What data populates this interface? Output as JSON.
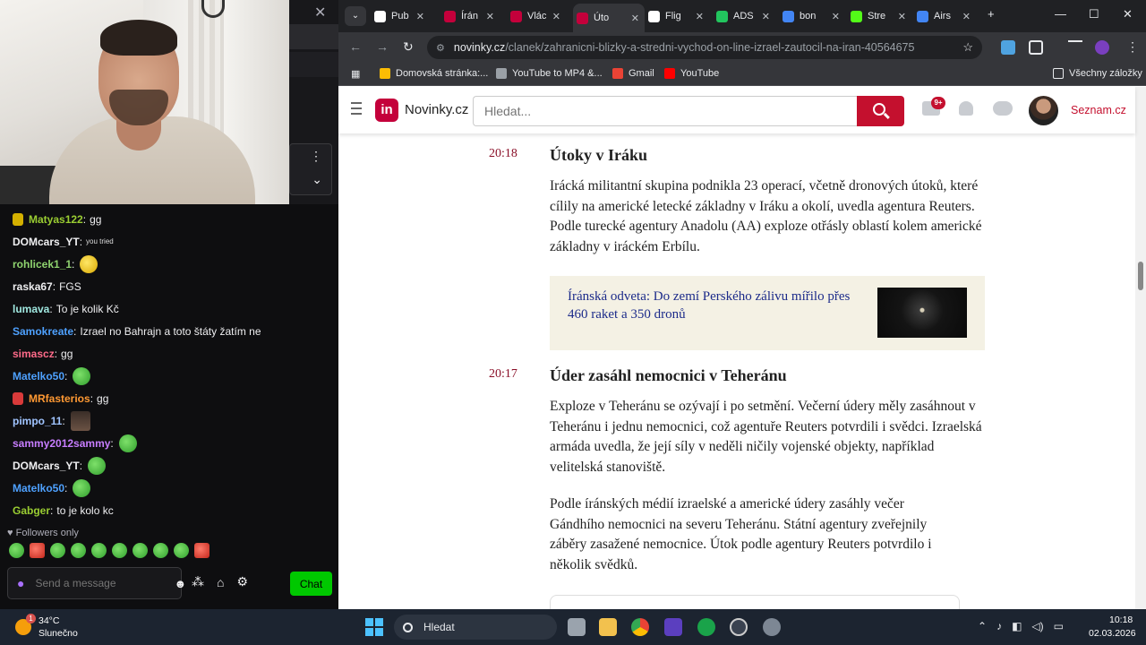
{
  "stream_chat": {
    "messages": [
      {
        "user": "Matyas122",
        "text": "gg",
        "color": "#9acd32",
        "badge": "#d4b000"
      },
      {
        "user": "DOMcars_YT",
        "text": "",
        "color": "#efeff1",
        "emote_text": "you tried"
      },
      {
        "user": "rohlicek1_1",
        "text": "",
        "color": "#8fd36f",
        "emote": "yellow"
      },
      {
        "user": "raska67",
        "text": "FGS",
        "color": "#efeff1"
      },
      {
        "user": "lumava",
        "text": "To je kolik Kč",
        "color": "#a0e8e0"
      },
      {
        "user": "Samokreate",
        "text": "Izrael no Bahrajn a toto štáty žatím ne",
        "color": "#4ea1ff"
      },
      {
        "user": "simascz",
        "text": "gg",
        "color": "#ff6b8a"
      },
      {
        "user": "Matelko50",
        "text": "",
        "color": "#4ea1ff",
        "emote": "green"
      },
      {
        "user": "MRfasterios",
        "text": "gg",
        "color": "#ff9933",
        "badge": "#d93a3a"
      },
      {
        "user": "pimpo_11",
        "text": "",
        "color": "#a0c4ff",
        "emote": "face"
      },
      {
        "user": "sammy2012sammy",
        "text": "",
        "color": "#c77dff",
        "emote": "green"
      },
      {
        "user": "DOMcars_YT",
        "text": "",
        "color": "#efeff1",
        "emote": "green"
      },
      {
        "user": "Matelko50",
        "text": "",
        "color": "#4ea1ff",
        "emote": "green"
      },
      {
        "user": "Gabger",
        "text": "to je kolo kc",
        "color": "#9acd32"
      }
    ],
    "followers_only": "Followers only",
    "input_placeholder": "Send a message",
    "chat_button": "Chat",
    "accent": "#a970ff"
  },
  "browser": {
    "tabs": [
      {
        "label": "Pub",
        "icon": "page-icon",
        "color": "#ffffff"
      },
      {
        "label": "Írán",
        "icon": "novinky-icon",
        "color": "#c4003b"
      },
      {
        "label": "Vlác",
        "icon": "novinky-icon",
        "color": "#c4003b"
      },
      {
        "label": "Úto",
        "icon": "novinky-icon",
        "color": "#c4003b",
        "active": true
      },
      {
        "label": "Flig",
        "icon": "flightradar-icon",
        "color": "#ffffff"
      },
      {
        "label": "ADS",
        "icon": "ads-icon",
        "color": "#22c55e"
      },
      {
        "label": "bon",
        "icon": "google-icon",
        "color": "#4285f4"
      },
      {
        "label": "Stre",
        "icon": "kick-icon",
        "color": "#53fc18"
      },
      {
        "label": "Airs",
        "icon": "google-icon",
        "color": "#4285f4"
      }
    ],
    "url_host": "novinky.cz",
    "url_path": "/clanek/zahranicni-blizky-a-stredni-vychod-on-line-izrael-zautocil-na-iran-40564675",
    "bookmarks": [
      {
        "label": "Domovská stránka:...",
        "color": "#fbbc04"
      },
      {
        "label": "YouTube to MP4 &...",
        "color": "#9aa0a6"
      },
      {
        "label": "Gmail",
        "color": "#ea4335"
      },
      {
        "label": "YouTube",
        "color": "#ff0000"
      }
    ],
    "all_bookmarks": "Všechny záložky"
  },
  "site": {
    "logo_mark": "in",
    "logo_text": "Novinky.cz",
    "search_placeholder": "Hledat...",
    "mail_badge": "9+",
    "seznam_link": "Seznam.cz",
    "brand_color": "#c4102e"
  },
  "article": {
    "entries": [
      {
        "time": "20:18",
        "heading": "Útoky v Iráku",
        "paragraphs": [
          "Irácká militantní skupina podnikla 23 operací, včetně dronových útoků, které cílily na americké letecké základny v Iráku a okolí, uvedla agentura Reuters. Podle turecké agentury Anadolu (AA) exploze otřásly oblastí kolem americké základny v iráckém Erbílu."
        ],
        "related": "Íránská odveta: Do zemí Perského zálivu mířilo přes 460 raket a 350 dronů"
      },
      {
        "time": "20:17",
        "heading": "Úder zasáhl nemocnici v Teheránu",
        "paragraphs": [
          "Exploze v Teheránu se ozývají i po setmění. Večerní údery měly zasáhnout v Teheránu i jednu nemocnici, což agentuře Reuters potvrdili i svědci. Izraelská armáda uvedla, že její síly v neděli ničily vojenské objekty, například velitelská stanoviště.",
          "Podle íránských médií izraelské a americké údery zasáhly večer Gándhího nemocnici na severu Teheránu. Státní agentury zveřejnily záběry zasažené nemocnice. Útok podle agentury Reuters potvrdilo i několik svědků."
        ]
      }
    ]
  },
  "taskbar": {
    "weather_temp": "34°C",
    "weather_desc": "Slunečno",
    "weather_badge": "1",
    "search_label": "Hledat",
    "time": "10:18",
    "date": "02.03.2026"
  }
}
